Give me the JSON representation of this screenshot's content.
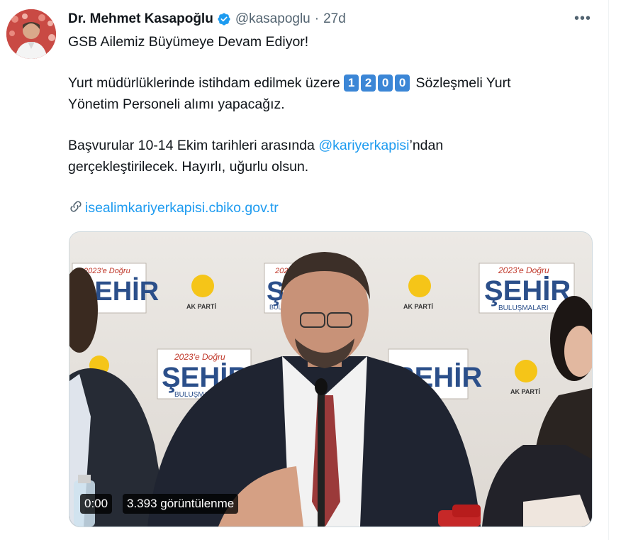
{
  "tweet": {
    "author_name": "Dr. Mehmet Kasapoğlu",
    "handle": "@kasapoglu",
    "separator": "·",
    "time": "27d",
    "more_label": "•••",
    "line1": "GSB Ailemiz Büyümeye Devam Ediyor!",
    "line2_before": "Yurt müdürlüklerinde istihdam edilmek üzere",
    "digits": [
      "1",
      "2",
      "0",
      "0"
    ],
    "line2_after": "Sözleşmeli Yurt",
    "line3": "Yönetim Personeli alımı yapacağız.",
    "line4_before": "Başvurular 10-14 Ekim tarihleri arasında",
    "mention": "@kariyerkapisi",
    "line4_after": "’ndan",
    "line5": "gerçekleştirilecek. Hayırlı, uğurlu olsun.",
    "link_icon": "🔗",
    "link": "isealimkariyerkapisi.cbiko.gov.tr"
  },
  "video": {
    "time": "0:00",
    "views": "3.393 görüntülenme",
    "backdrop": {
      "banner_top": "2023'e Doğru",
      "banner_main": "ŞEHİR",
      "banner_sub": "BULUŞMALARI",
      "party": "AK PARTİ"
    }
  },
  "colors": {
    "accent": "#1d9bf0",
    "digit_box": "#3b86d6",
    "secondary_text": "#536471"
  }
}
